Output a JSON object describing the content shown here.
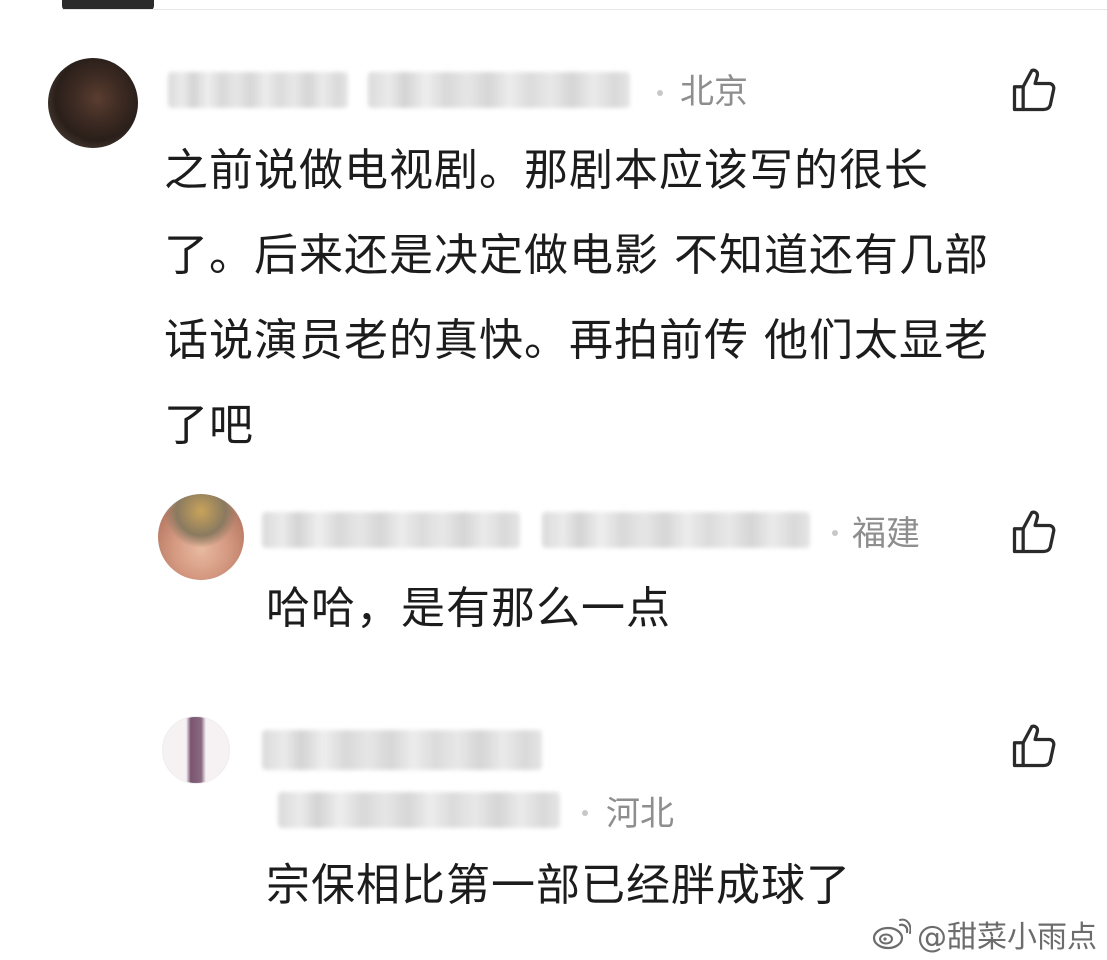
{
  "comments": [
    {
      "location": "北京",
      "text_lines": [
        "之前说做电视剧。那剧本应该写的很长",
        "了。后来还是决定做电影 不知道还有几部",
        "话说演员老的真快。再拍前传 他们太显老",
        "了吧"
      ]
    },
    {
      "location": "福建",
      "text": "哈哈，是有那么一点"
    },
    {
      "location": "河北",
      "text": "宗保相比第一部已经胖成球了"
    }
  ],
  "watermark": {
    "text": "@甜菜小雨点",
    "icon": "weibo-logo-icon"
  },
  "icons": {
    "like": "thumbs-up-icon"
  },
  "colors": {
    "text": "#1c1c1c",
    "meta": "#8e8e8e",
    "background": "#ffffff"
  }
}
